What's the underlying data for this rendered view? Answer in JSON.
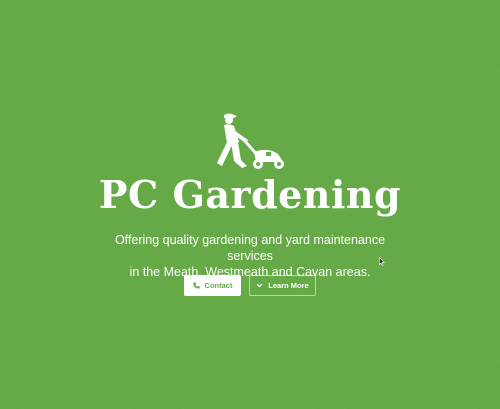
{
  "hero": {
    "logo_icon": "lawn-mower-person-icon",
    "title": "PC Gardening",
    "tagline": {
      "line1": "Offering quality gardening and yard maintenance services",
      "line2": "in the Meath, Westmeath and Cavan areas."
    },
    "buttons": {
      "contact": {
        "label": "Contact",
        "icon": "phone-icon"
      },
      "learn_more": {
        "label": "Learn More",
        "icon": "chevron-down-icon"
      }
    }
  },
  "colors": {
    "background": "#65aa46",
    "text": "#ffffff",
    "primary_button_bg": "#ffffff",
    "primary_button_text": "#65aa46"
  }
}
